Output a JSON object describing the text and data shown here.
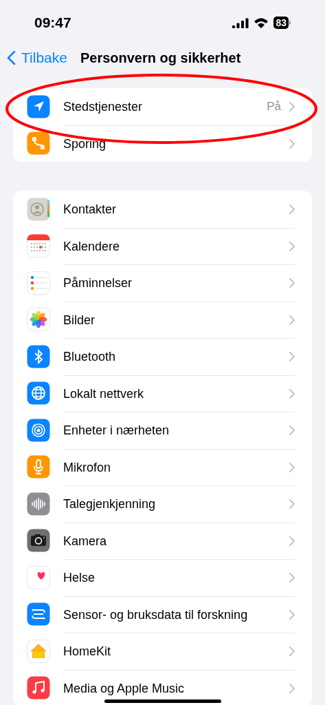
{
  "status_bar": {
    "time": "09:47",
    "battery": "83"
  },
  "nav": {
    "back": "Tilbake",
    "title": "Personvern og sikkerhet"
  },
  "highlight": {
    "kind": "ellipse"
  },
  "sections": [
    {
      "rows": [
        {
          "label": "Stedstjenester",
          "value": "På"
        },
        {
          "label": "Sporing"
        }
      ]
    },
    {
      "rows": [
        {
          "label": "Kontakter"
        },
        {
          "label": "Kalendere"
        },
        {
          "label": "Påminnelser"
        },
        {
          "label": "Bilder"
        },
        {
          "label": "Bluetooth"
        },
        {
          "label": "Lokalt nettverk"
        },
        {
          "label": "Enheter i nærheten"
        },
        {
          "label": "Mikrofon"
        },
        {
          "label": "Talegjenkjenning"
        },
        {
          "label": "Kamera"
        },
        {
          "label": "Helse"
        },
        {
          "label": "Sensor- og bruksdata til forskning"
        },
        {
          "label": "HomeKit"
        },
        {
          "label": "Media og Apple Music"
        }
      ]
    }
  ]
}
